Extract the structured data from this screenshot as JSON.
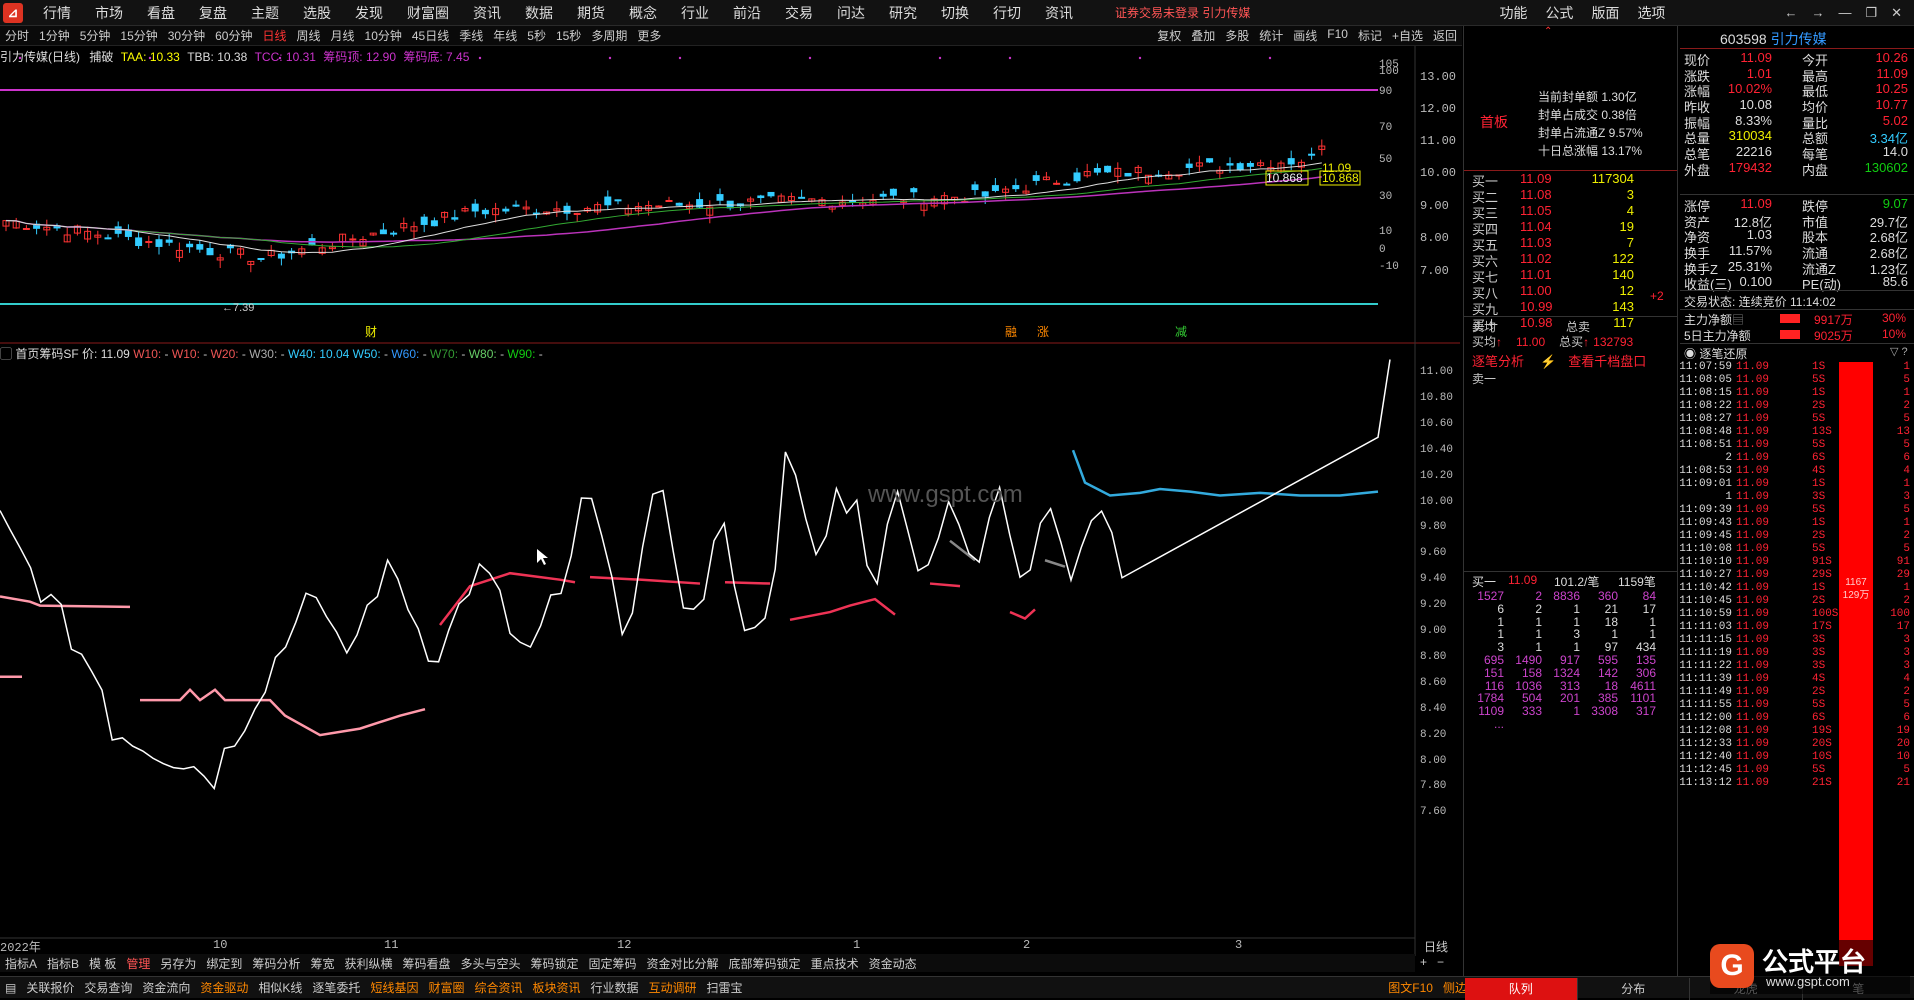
{
  "menu": {
    "items": [
      "行情",
      "市场",
      "看盘",
      "复盘",
      "主题",
      "选股",
      "发现",
      "财富圈",
      "资讯",
      "数据",
      "期货",
      "概念",
      "行业",
      "前沿",
      "交易",
      "问达",
      "研究",
      "切换",
      "行切",
      "资讯"
    ],
    "notice": "证券交易未登录 引力传媒",
    "right": [
      "功能",
      "公式",
      "版面",
      "选项"
    ]
  },
  "periods": [
    "分时",
    "1分钟",
    "5分钟",
    "15分钟",
    "30分钟",
    "60分钟",
    "日线",
    "周线",
    "月线",
    "10分钟",
    "45日线",
    "季线",
    "年线",
    "5秒",
    "15秒",
    "多周期",
    "更多"
  ],
  "tools": [
    "复权",
    "叠加",
    "多股",
    "统计",
    "画线",
    "F10",
    "标记",
    "+自选",
    "返回"
  ],
  "kline": {
    "title": "引力传媒(日线)",
    "ind": "捕破",
    "taa": "TAA: 10.33",
    "tbb": "TBB: 10.38",
    "tcc": "TCC: 10.31",
    "cmd": "筹码顶: 12.90",
    "cmd2": "筹码底: 7.45",
    "low_label": "←7.39",
    "hi_label": "11.09",
    "ma1": "10.868",
    "ma2": "10.868",
    "marks": [
      "财",
      "融",
      "涨",
      "减"
    ]
  },
  "price_axis": [
    "13.00",
    "12.00",
    "11.00",
    "10.00",
    "9.00",
    "8.00",
    "7.00"
  ],
  "osc_axis": [
    "105",
    "100",
    "90",
    "70",
    "50",
    "30",
    "10",
    "0",
    "-10"
  ],
  "chip": {
    "title": "首页筹码SF",
    "price": "价: 11.09",
    "w": [
      "W10:",
      "W10:",
      "W20:",
      "W30:",
      "W40: 10.04",
      "W50:",
      "W60:",
      "W70:",
      "W80:",
      "W90:"
    ]
  },
  "chip_axis": [
    "11.00",
    "10.80",
    "10.60",
    "10.40",
    "10.20",
    "10.00",
    "9.80",
    "9.60",
    "9.40",
    "9.20",
    "9.00",
    "8.80",
    "8.60",
    "8.40",
    "8.20",
    "8.00",
    "7.80",
    "7.60"
  ],
  "x_labels": [
    "2022年",
    "10",
    "11",
    "12",
    "1",
    "2",
    "3"
  ],
  "x_label_day": "日线",
  "watermark": "www.gspt.com",
  "bottom_tabs": [
    "指标A",
    "指标B",
    "模 板",
    "管理",
    "另存为",
    "绑定到",
    "筹码分析",
    "筹宽",
    "获利纵横",
    "筹码看盘",
    "多头与空头",
    "筹码锁定",
    "固定筹码",
    "资金对比分解",
    "底部筹码锁定",
    "重点技术",
    "资金动态"
  ],
  "bottom_tabs2": [
    "关联报价",
    "交易查询",
    "资金流向",
    "资金驱动",
    "相似K线",
    "逐笔委托",
    "短线基因",
    "财富圈",
    "综合资讯",
    "板块资讯",
    "行业数据",
    "互动调研",
    "扫雷宝"
  ],
  "bottom_right": [
    "图文F10",
    "侧边栏"
  ],
  "order": {
    "head": "首板",
    "lines": [
      "当前封单额 1.30亿",
      "封单占成交 0.38倍",
      "封单占流通Z 9.57%",
      "十日总涨幅 13.17%"
    ],
    "bids": [
      [
        "买一",
        "11.09",
        "117304"
      ],
      [
        "买二",
        "11.08",
        "3"
      ],
      [
        "买三",
        "11.05",
        "4"
      ],
      [
        "买四",
        "11.04",
        "19"
      ],
      [
        "买五",
        "11.03",
        "7"
      ],
      [
        "买六",
        "11.02",
        "122"
      ],
      [
        "买七",
        "11.01",
        "140"
      ],
      [
        "买八",
        "11.00",
        "12"
      ],
      [
        "买九",
        "10.99",
        "143"
      ],
      [
        "买十",
        "10.98",
        "117"
      ]
    ],
    "avg_sell": "卖均",
    "total_sell": "总卖",
    "avg_buy": "买均",
    "avg_buy_val": "11.00",
    "total_buy": "总买",
    "total_buy_val": "132793",
    "extra": "+2",
    "link1": "逐笔分析",
    "link2": "查看千档盘口",
    "sell1": "卖一",
    "q_head": [
      "买一",
      "11.09",
      "101.2/笔",
      "1159笔"
    ],
    "q_rows": [
      [
        "1527",
        "2",
        "8836",
        "360",
        "84"
      ],
      [
        "6",
        "2",
        "1",
        "21",
        "17"
      ],
      [
        "1",
        "1",
        "1",
        "18",
        "1"
      ],
      [
        "1",
        "1",
        "3",
        "1",
        "1"
      ],
      [
        "3",
        "1",
        "1",
        "97",
        "434"
      ],
      [
        "695",
        "1490",
        "917",
        "595",
        "135"
      ],
      [
        "151",
        "158",
        "1324",
        "142",
        "306"
      ],
      [
        "116",
        "1036",
        "313",
        "18",
        "4611"
      ],
      [
        "1784",
        "504",
        "201",
        "385",
        "1101"
      ],
      [
        "1109",
        "333",
        "1",
        "3308",
        "317"
      ],
      [
        "...",
        "",
        "",
        "",
        ""
      ]
    ]
  },
  "quote": {
    "code": "603598",
    "name": "引力传媒",
    "rows": [
      [
        "现价",
        "11.09",
        "今开",
        "10.26"
      ],
      [
        "涨跌",
        "1.01",
        "最高",
        "11.09"
      ],
      [
        "涨幅",
        "10.02%",
        "最低",
        "10.25"
      ],
      [
        "昨收",
        "10.08",
        "均价",
        "10.77"
      ],
      [
        "振幅",
        "8.33%",
        "量比",
        "5.02"
      ],
      [
        "总量",
        "310034",
        "总额",
        "3.34亿"
      ],
      [
        "总笔",
        "22216",
        "每笔",
        "14.0"
      ],
      [
        "外盘",
        "179432",
        "内盘",
        "130602"
      ]
    ],
    "rows2": [
      [
        "涨停",
        "11.09",
        "跌停",
        "9.07"
      ],
      [
        "资产",
        "12.8亿",
        "市值",
        "29.7亿"
      ],
      [
        "净资",
        "1.03",
        "股本",
        "2.68亿"
      ],
      [
        "换手",
        "11.57%",
        "流通",
        "2.68亿"
      ],
      [
        "换手Z",
        "25.31%",
        "流通Z",
        "1.23亿"
      ],
      [
        "收益(三)",
        "0.100",
        "PE(动)",
        "85.6"
      ]
    ],
    "status": "交易状态: 连续竞价 11:14:02",
    "main_net": [
      "主力净额",
      "9917万",
      "30%"
    ],
    "main5": [
      "5日主力净额",
      "9025万",
      "10%"
    ],
    "tick_head": "逐笔还原",
    "ticks": [
      [
        "11:07:59",
        "11.09",
        "1S",
        "1"
      ],
      [
        "11:08:05",
        "11.09",
        "5S",
        "5"
      ],
      [
        "11:08:15",
        "11.09",
        "1S",
        "1"
      ],
      [
        "11:08:22",
        "11.09",
        "2S",
        "2"
      ],
      [
        "11:08:27",
        "11.09",
        "5S",
        "5"
      ],
      [
        "11:08:48",
        "11.09",
        "13S",
        "13"
      ],
      [
        "11:08:51",
        "11.09",
        "5S",
        "5"
      ],
      [
        "2",
        "11.09",
        "6S",
        "6"
      ],
      [
        "11:08:53",
        "11.09",
        "4S",
        "4"
      ],
      [
        "11:09:01",
        "11.09",
        "1S",
        "1"
      ],
      [
        "1",
        "11.09",
        "3S",
        "3"
      ],
      [
        "11:09:39",
        "11.09",
        "5S",
        "5"
      ],
      [
        "11:09:43",
        "11.09",
        "1S",
        "1"
      ],
      [
        "11:09:45",
        "11.09",
        "2S",
        "2"
      ],
      [
        "11:10:08",
        "11.09",
        "5S",
        "5"
      ],
      [
        "11:10:10",
        "11.09",
        "91S",
        "91"
      ],
      [
        "11:10:27",
        "11.09",
        "29S",
        "29"
      ],
      [
        "11:10:42",
        "11.09",
        "1S",
        "1"
      ],
      [
        "11:10:45",
        "11.09",
        "2S",
        "2"
      ],
      [
        "11:10:59",
        "11.09",
        "100S",
        "100"
      ],
      [
        "11:11:03",
        "11.09",
        "17S",
        "17"
      ],
      [
        "11:11:15",
        "11.09",
        "3S",
        "3"
      ],
      [
        "11:11:19",
        "11.09",
        "3S",
        "3"
      ],
      [
        "11:11:22",
        "11.09",
        "3S",
        "3"
      ],
      [
        "11:11:39",
        "11.09",
        "4S",
        "4"
      ],
      [
        "11:11:49",
        "11.09",
        "2S",
        "2"
      ],
      [
        "11:11:55",
        "11.09",
        "5S",
        "5"
      ],
      [
        "11:12:00",
        "11.09",
        "6S",
        "6"
      ],
      [
        "11:12:08",
        "11.09",
        "19S",
        "19"
      ],
      [
        "11:12:33",
        "11.09",
        "20S",
        "20"
      ],
      [
        "11:12:40",
        "11.09",
        "10S",
        "10"
      ],
      [
        "11:12:45",
        "11.09",
        "5S",
        "5"
      ],
      [
        "11:13:12",
        "11.09",
        "21S",
        "21"
      ]
    ],
    "bar_label": "1167\n129万",
    "tabs": [
      "队列",
      "分布",
      "龙虎",
      "笔"
    ]
  },
  "brand": "公式平台",
  "brand_url": "www.gspt.com"
}
